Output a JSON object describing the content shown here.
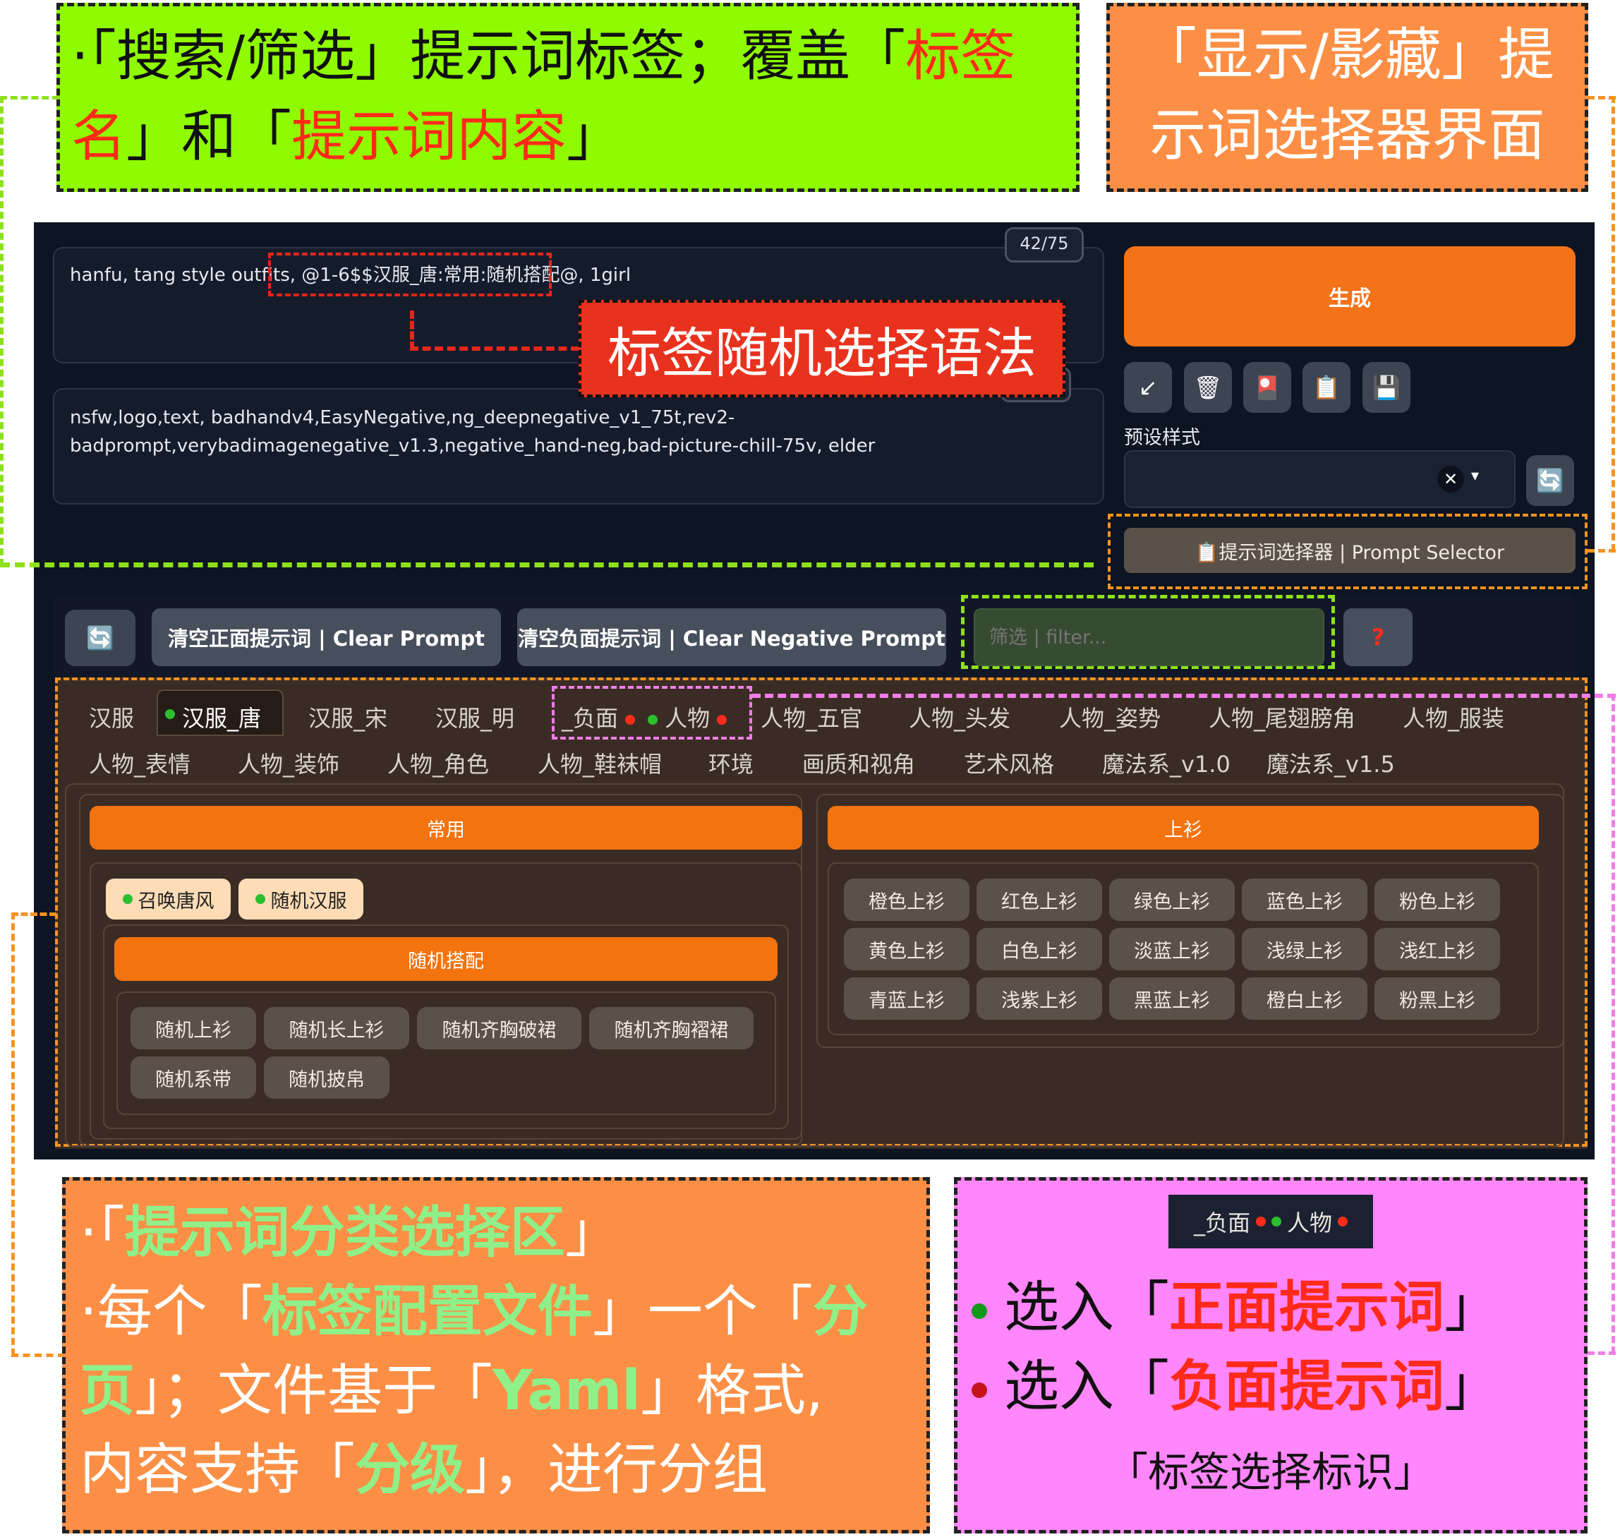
{
  "annotations": {
    "search_filter": {
      "prefix": "·「搜索/筛选」提示词标签；覆盖「",
      "highlight1": "标签名",
      "middle": "」和「",
      "highlight2": "提示词内容",
      "suffix": "」"
    },
    "toggle_ui": "「显示/影藏」提示词选择器界面",
    "syntax_label": "标签随机选择语法",
    "category_area": {
      "line1_prefix": "·「",
      "line1_highlight": "提示词分类选择区",
      "line1_suffix": "」",
      "line2_prefix": "·每个「",
      "line2_highlight1": "标签配置文件",
      "line2_middle": "」一个「",
      "line2_highlight2": "分页",
      "line2_suffix": "」；文件基于「",
      "line2_highlight3": "Yaml",
      "line2_suffix2": "」格式,",
      "line3_prefix": "内容支持「",
      "line3_highlight": "分级",
      "line3_suffix": "」，进行分组"
    },
    "tag_marker": {
      "sample_text1": "_负面",
      "sample_text2": "人物",
      "positive_prefix": "选入「",
      "positive_highlight": "正面提示词",
      "positive_suffix": "」",
      "negative_prefix": "选入「",
      "negative_highlight": "负面提示词",
      "negative_suffix": "」",
      "caption": "「标签选择标识」"
    }
  },
  "prompt": {
    "positive_before": "hanfu, tang style outfits, ",
    "positive_syntax": "@1-6$$汉服_唐:常用:随机搭配@,",
    "positive_after": " 1girl",
    "counter": "42/75",
    "negative": "nsfw,logo,text, badhandv4,EasyNegative,ng_deepnegative_v1_75t,rev2-badprompt,verybadimagenegative_v1.3,negative_hand-neg,bad-picture-chill-75v, elder"
  },
  "sidebar": {
    "generate_label": "生成",
    "tools": [
      "↙",
      "🗑",
      "🎴",
      "📋",
      "💾"
    ],
    "styles_label": "预设样式",
    "styles_clear": "✕",
    "styles_caret": "▾",
    "refresh_icon": "🔄",
    "prompt_selector_label": "📋提示词选择器 | Prompt Selector"
  },
  "toolbar": {
    "refresh_icon": "🔄",
    "clear_prompt": "清空正面提示词 | Clear Prompt",
    "clear_negative": "清空负面提示词 | Clear Negative Prompt",
    "filter_placeholder": "筛选 | filter...",
    "help": "?"
  },
  "tabs": {
    "row1": [
      "汉服",
      "汉服_唐",
      "汉服_宋",
      "汉服_明",
      "_负面",
      "人物",
      "人物_五官",
      "人物_头发",
      "人物_姿势",
      "人物_尾翅膀角",
      "人物_服装"
    ],
    "row2": [
      "人物_表情",
      "人物_装饰",
      "人物_角色",
      "人物_鞋袜帽",
      "环境",
      "画质和视角",
      "艺术风格",
      "魔法系_v1.0",
      "魔法系_v1.5"
    ],
    "active": "汉服_唐"
  },
  "panel_left": {
    "header": "常用",
    "chips_top": [
      "召唤唐风",
      "随机汉服"
    ],
    "sub_header": "随机搭配",
    "chips": [
      "随机上衫",
      "随机长上衫",
      "随机齐胸破裙",
      "随机齐胸褶裙",
      "随机系带",
      "随机披帛"
    ]
  },
  "panel_right": {
    "header": "上衫",
    "chips": [
      "橙色上衫",
      "红色上衫",
      "绿色上衫",
      "蓝色上衫",
      "粉色上衫",
      "黄色上衫",
      "白色上衫",
      "淡蓝上衫",
      "浅绿上衫",
      "浅红上衫",
      "青蓝上衫",
      "浅紫上衫",
      "黑蓝上衫",
      "橙白上衫",
      "粉黑上衫"
    ]
  },
  "colors": {
    "accent_orange": "#f47218",
    "positive_dot": "#2bbf2e",
    "negative_dot": "#ff2c1c",
    "highlight_red": "#ff2a1a",
    "highlight_green": "#8ff08a"
  }
}
